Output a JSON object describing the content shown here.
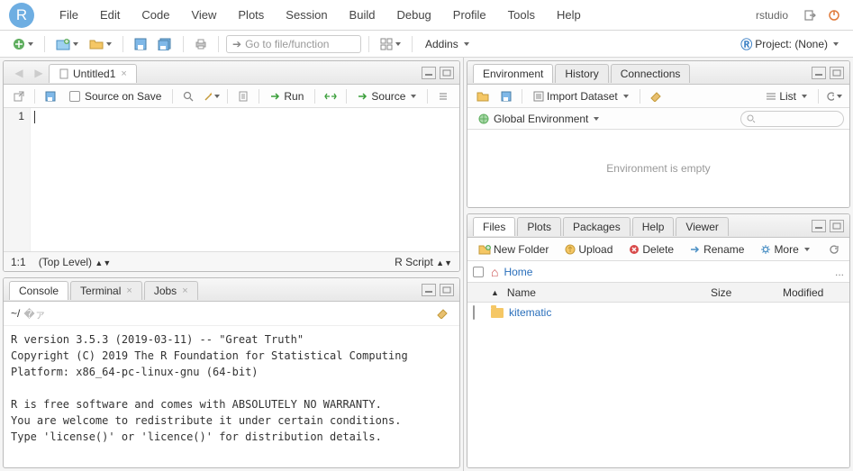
{
  "app": {
    "name": "rstudio"
  },
  "menu": [
    "File",
    "Edit",
    "Code",
    "View",
    "Plots",
    "Session",
    "Build",
    "Debug",
    "Profile",
    "Tools",
    "Help"
  ],
  "toolbar": {
    "goto_placeholder": "Go to file/function",
    "addins": "Addins",
    "project": "Project: (None)"
  },
  "source": {
    "tab": "Untitled1",
    "source_on_save": "Source on Save",
    "run": "Run",
    "source_btn": "Source",
    "first_line_no": "1",
    "status_pos": "1:1",
    "status_scope": "(Top Level)",
    "status_lang": "R Script"
  },
  "console": {
    "tabs": [
      "Console",
      "Terminal",
      "Jobs"
    ],
    "path": "~/",
    "text": "R version 3.5.3 (2019-03-11) -- \"Great Truth\"\nCopyright (C) 2019 The R Foundation for Statistical Computing\nPlatform: x86_64-pc-linux-gnu (64-bit)\n\nR is free software and comes with ABSOLUTELY NO WARRANTY.\nYou are welcome to redistribute it under certain conditions.\nType 'license()' or 'licence()' for distribution details."
  },
  "env": {
    "tabs": [
      "Environment",
      "History",
      "Connections"
    ],
    "import": "Import Dataset",
    "list_mode": "List",
    "scope": "Global Environment",
    "empty_msg": "Environment is empty"
  },
  "files": {
    "tabs": [
      "Files",
      "Plots",
      "Packages",
      "Help",
      "Viewer"
    ],
    "new_folder": "New Folder",
    "upload": "Upload",
    "delete": "Delete",
    "rename": "Rename",
    "more": "More",
    "home": "Home",
    "cols": {
      "name": "Name",
      "size": "Size",
      "modified": "Modified"
    },
    "rows": [
      {
        "name": "kitematic",
        "kind": "folder",
        "link": true
      }
    ]
  }
}
